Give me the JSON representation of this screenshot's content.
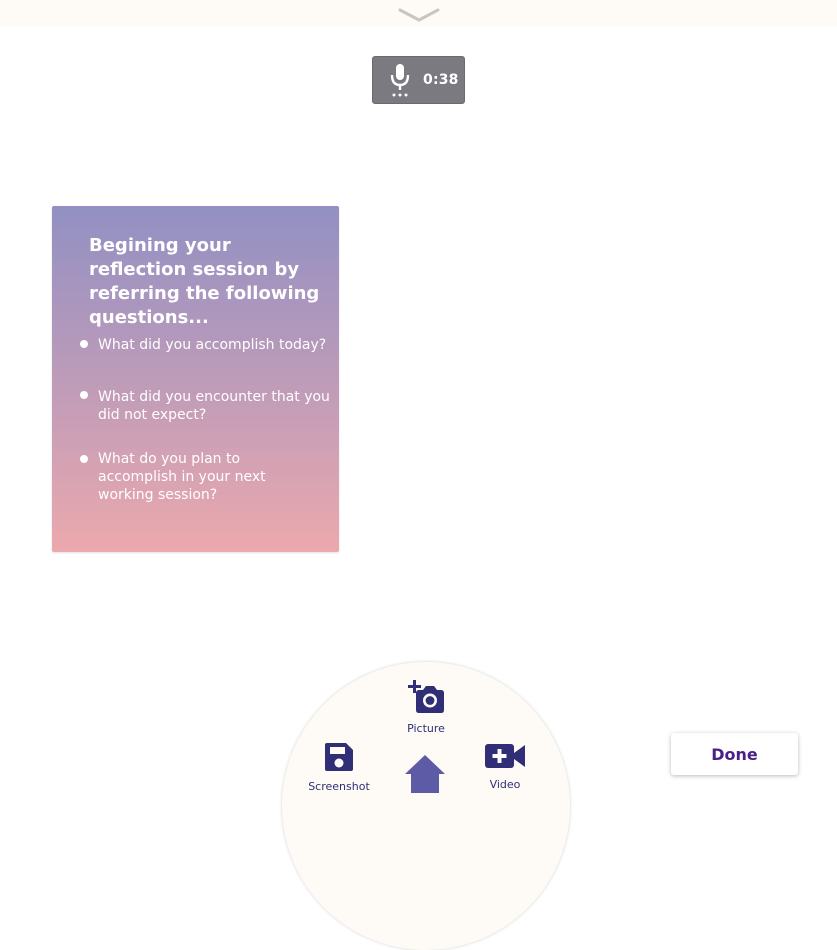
{
  "colors": {
    "top_bar": "#fefbf7",
    "recording_badge": "#7a7a80",
    "card_gradient_top": "#9290c3",
    "card_gradient_bottom": "#eca9ad",
    "tool_icon": "#2f2e76",
    "done_text": "#4b1f86"
  },
  "top_bar": {
    "icon": "chevron-down-icon"
  },
  "recording": {
    "icon": "microphone-icon",
    "elapsed": "0:38"
  },
  "reflection_card": {
    "title": "Begining your reflection session by referring the following questions...",
    "questions": [
      "What did you accomplish today?",
      "What did you encounter that you did not expect?",
      "What do you plan to accomplish in your next working session?"
    ]
  },
  "toolbar": {
    "picture": {
      "label": "Picture",
      "icon": "add-photo-icon"
    },
    "screenshot": {
      "label": "Screenshot",
      "icon": "save-icon"
    },
    "video": {
      "label": "Video",
      "icon": "add-video-icon"
    },
    "home": {
      "icon": "home-icon"
    }
  },
  "done_label": "Done"
}
